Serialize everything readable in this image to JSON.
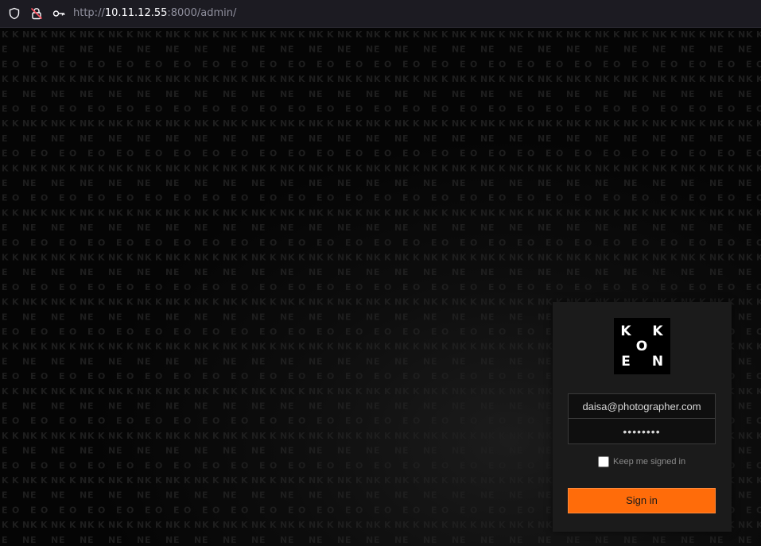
{
  "browser": {
    "url_scheme": "http://",
    "url_host": "10.11.12.55",
    "url_path": ":8000/admin/",
    "icons": [
      "shield-icon",
      "insecure-lock-icon",
      "key-icon"
    ]
  },
  "background": {
    "pattern_letters": [
      "K",
      "N",
      "E",
      "O"
    ],
    "color": "#0a0a0a"
  },
  "login": {
    "logo_letters": {
      "top_left": "K",
      "top_right": "K",
      "center": "O",
      "bottom_left": "E",
      "bottom_right": "N"
    },
    "email_value": "daisa@photographer.com",
    "password_masked": "••••••••",
    "keep_signed_in_label": "Keep me signed in",
    "keep_signed_in_checked": false,
    "sign_in_label": "Sign in",
    "accent_color": "#ff6c0a"
  }
}
